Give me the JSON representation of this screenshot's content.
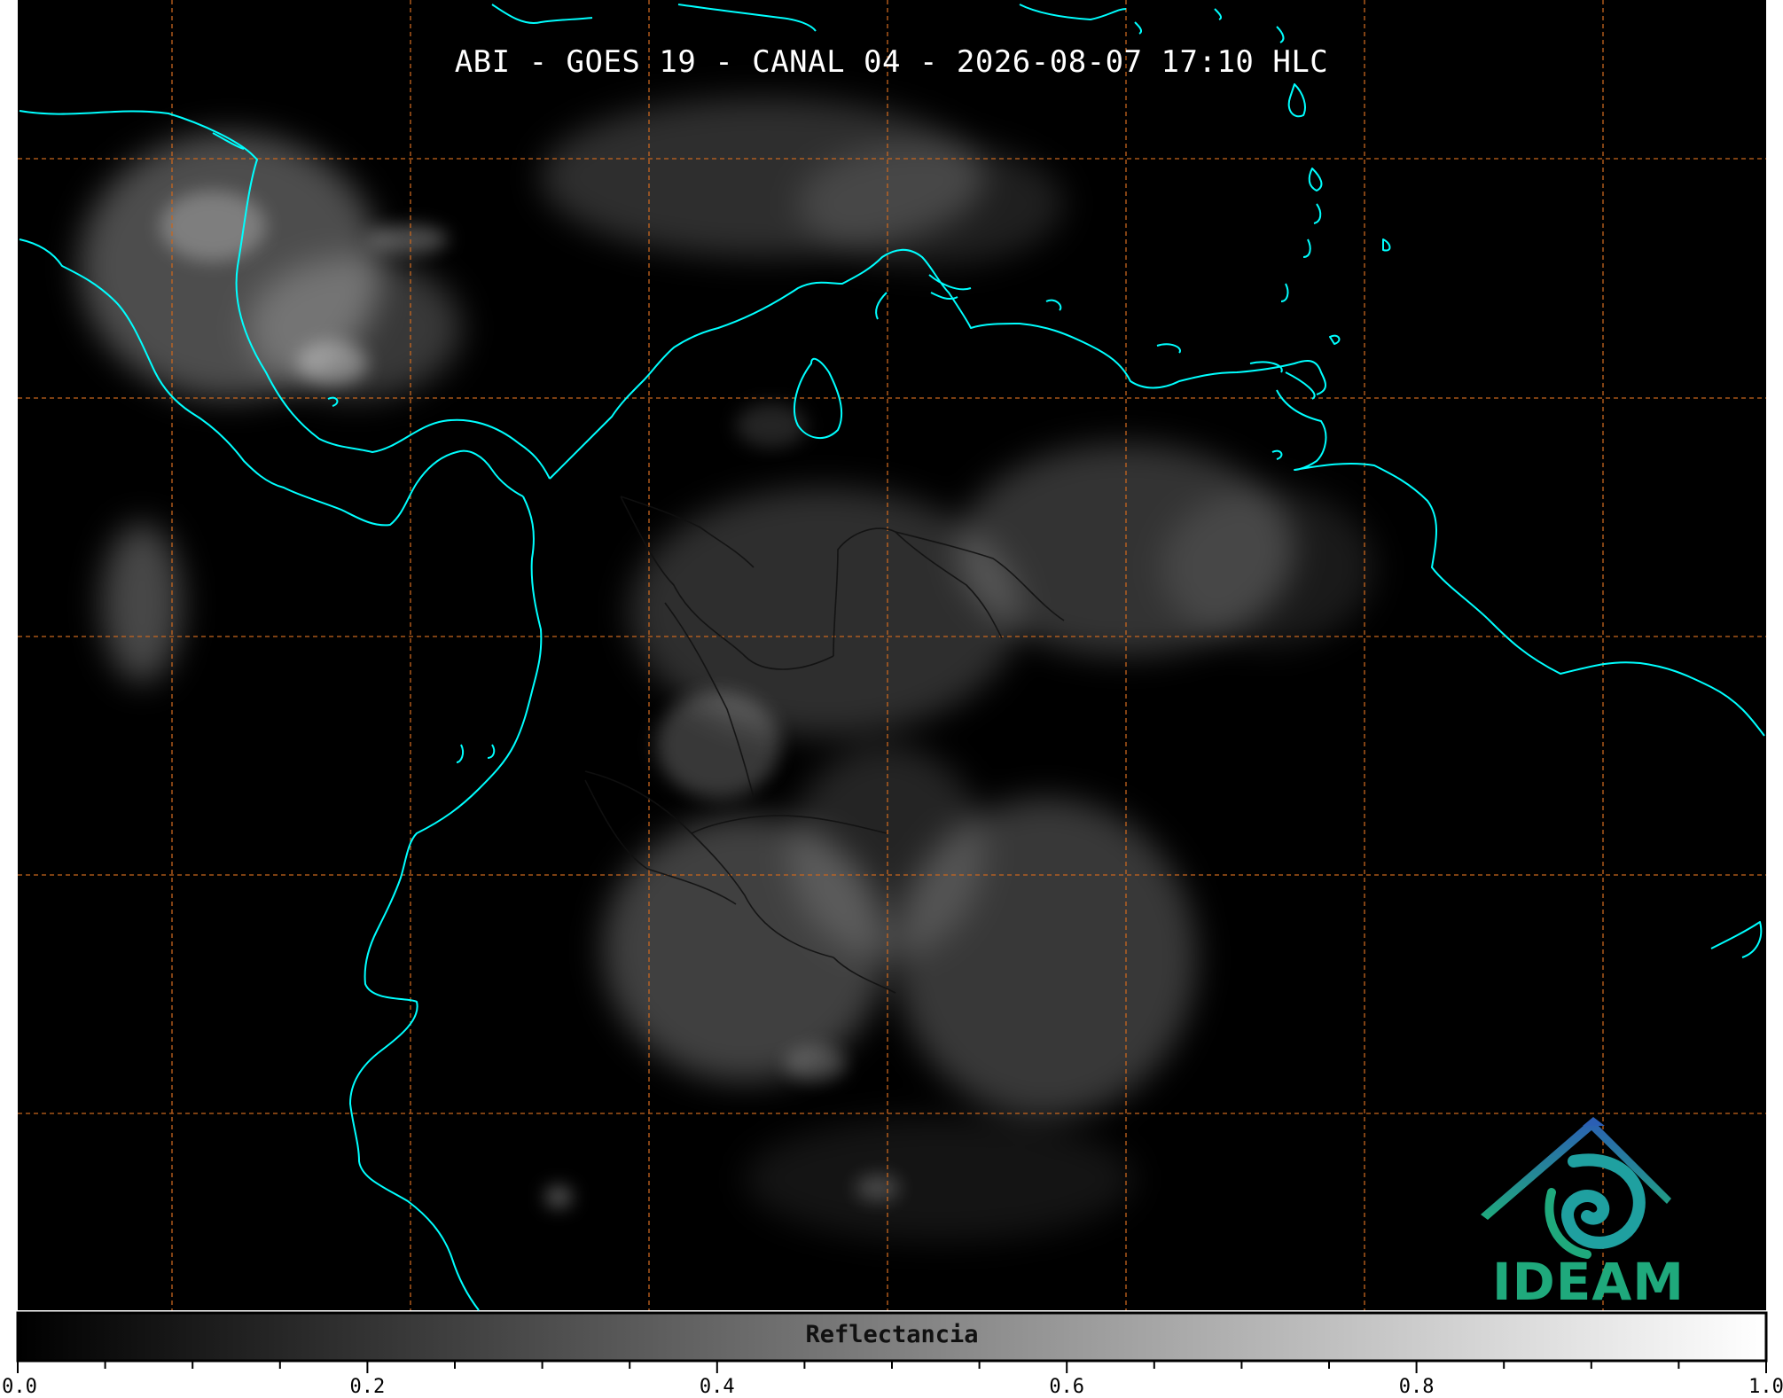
{
  "title": "ABI - GOES 19 - CANAL 04 - 2026-08-07 17:10 HLC",
  "colorbar": {
    "label": "Reflectancia",
    "range": [
      0.0,
      1.0
    ],
    "ticks": [
      "0.0",
      "0.2",
      "0.4",
      "0.6",
      "0.8",
      "1.0"
    ],
    "colormap": [
      "#000000",
      "#ffffff"
    ]
  },
  "logo": {
    "text": "IDEAM",
    "icon": "ideam-logo-icon",
    "color": "#1fa97c"
  },
  "colors": {
    "background": "#000000",
    "coastline": "#00ffff",
    "graticule": "#c8661e",
    "borders": "#000000"
  }
}
